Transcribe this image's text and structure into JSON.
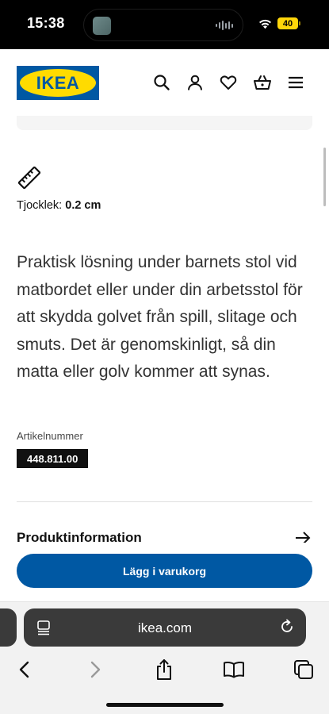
{
  "status_bar": {
    "time": "15:38",
    "battery": "40",
    "icons": [
      "wifi-icon",
      "battery-icon"
    ],
    "battery_color": "#ffd60a"
  },
  "header": {
    "logo_text": "IKEA",
    "brand_blue": "#0058a3",
    "brand_yellow": "#ffdb00",
    "icons": [
      "search-icon",
      "account-icon",
      "heart-icon",
      "basket-icon",
      "menu-icon"
    ]
  },
  "product": {
    "thickness_label": "Tjocklek:",
    "thickness_value": "0.2 cm",
    "description": "Praktisk lösning under barnets stol vid matbordet eller under din arbetsstol för att skydda golvet från spill, slitage och smuts. Det är genomskinligt, så din matta eller golv kommer att synas.",
    "article_label": "Artikelnummer",
    "article_number": "448.811.00",
    "product_info_label": "Produktinformation"
  },
  "cta": {
    "add_to_cart": "Lägg i varukorg"
  },
  "browser": {
    "url": "ikea.com",
    "toolbar_icons": [
      "back-icon",
      "forward-icon",
      "share-icon",
      "bookmarks-icon",
      "tabs-icon"
    ]
  }
}
